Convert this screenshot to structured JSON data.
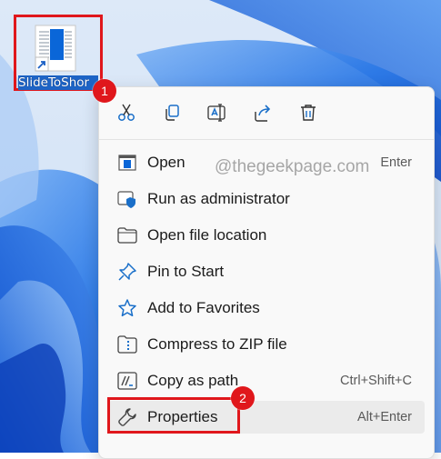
{
  "desktop": {
    "shortcut_label": "SlideToShor",
    "shortcut_icon": "document-shortcut-icon"
  },
  "badges": {
    "step1": "1",
    "step2": "2"
  },
  "watermark": "@thegeekpage.com",
  "toolbar": [
    {
      "name": "cut",
      "icon": "scissors-icon"
    },
    {
      "name": "copy",
      "icon": "copy-icon"
    },
    {
      "name": "rename",
      "icon": "rename-icon"
    },
    {
      "name": "share",
      "icon": "share-icon"
    },
    {
      "name": "delete",
      "icon": "trash-icon"
    }
  ],
  "menu_items": [
    {
      "label": "Open",
      "shortcut": "Enter",
      "icon": "open-app-icon"
    },
    {
      "label": "Run as administrator",
      "shortcut": "",
      "icon": "shield-admin-icon"
    },
    {
      "label": "Open file location",
      "shortcut": "",
      "icon": "folder-icon"
    },
    {
      "label": "Pin to Start",
      "shortcut": "",
      "icon": "pin-icon"
    },
    {
      "label": "Add to Favorites",
      "shortcut": "",
      "icon": "star-icon"
    },
    {
      "label": "Compress to ZIP file",
      "shortcut": "",
      "icon": "zip-folder-icon"
    },
    {
      "label": "Copy as path",
      "shortcut": "Ctrl+Shift+C",
      "icon": "path-icon"
    },
    {
      "label": "Properties",
      "shortcut": "Alt+Enter",
      "icon": "wrench-icon"
    }
  ],
  "colors": {
    "accent": "#0067c0",
    "highlight": "#e0171c",
    "menu_bg": "#f9f9f9",
    "wallpaper_blue": "#1f6fe0"
  }
}
